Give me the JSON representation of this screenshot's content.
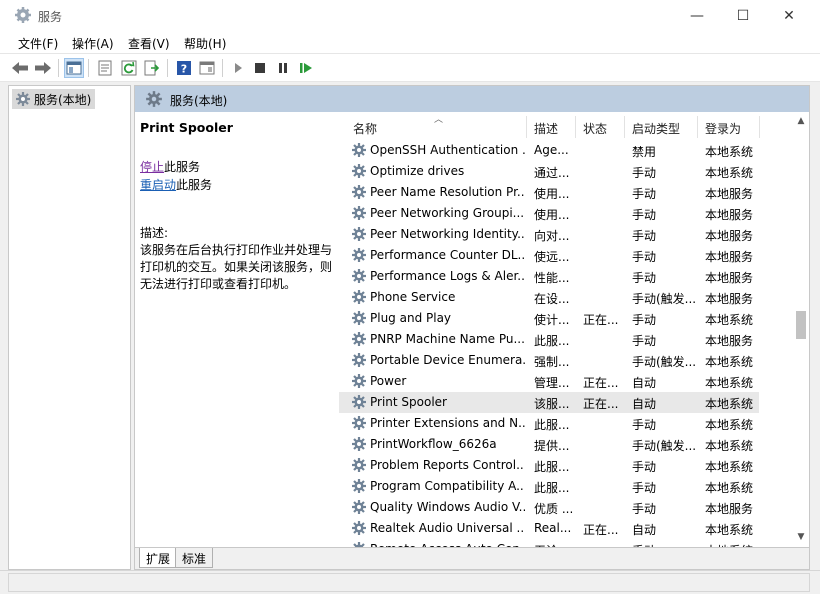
{
  "window": {
    "title": "服务",
    "controls": {
      "minimize": "—",
      "maximize": "☐",
      "close": "✕"
    }
  },
  "menu": {
    "items": [
      "文件(F)",
      "操作(A)",
      "查看(V)",
      "帮助(H)"
    ]
  },
  "toolbar": {
    "icons": [
      "back-arrow-icon",
      "forward-arrow-icon",
      "console-tree-icon",
      "properties-icon",
      "refresh-icon",
      "export-list-icon",
      "help-icon",
      "show-hide-icon",
      "start-service-icon",
      "stop-service-icon",
      "pause-service-icon",
      "restart-service-icon"
    ]
  },
  "tree": {
    "selected": "服务(本地)"
  },
  "content": {
    "header": "服务(本地)",
    "selected_service": "Print Spooler",
    "actions": [
      {
        "link": "停止",
        "suffix": "此服务"
      },
      {
        "link": "重启动",
        "suffix": "此服务"
      }
    ],
    "desc_label": "描述:",
    "desc_text": "该服务在后台执行打印作业并处理与打印机的交互。如果关闭该服务，则无法进行打印或查看打印机。"
  },
  "columns": {
    "name": "名称",
    "desc": "描述",
    "status": "状态",
    "startup": "启动类型",
    "logon": "登录为"
  },
  "services": [
    {
      "name": "OpenSSH Authentication ...",
      "desc": "Age...",
      "status": "",
      "startup": "禁用",
      "logon": "本地系统"
    },
    {
      "name": "Optimize drives",
      "desc": "通过...",
      "status": "",
      "startup": "手动",
      "logon": "本地系统"
    },
    {
      "name": "Peer Name Resolution Pr...",
      "desc": "使用...",
      "status": "",
      "startup": "手动",
      "logon": "本地服务"
    },
    {
      "name": "Peer Networking Groupi...",
      "desc": "使用...",
      "status": "",
      "startup": "手动",
      "logon": "本地服务"
    },
    {
      "name": "Peer Networking Identity...",
      "desc": "向对...",
      "status": "",
      "startup": "手动",
      "logon": "本地服务"
    },
    {
      "name": "Performance Counter DL...",
      "desc": "使远...",
      "status": "",
      "startup": "手动",
      "logon": "本地服务"
    },
    {
      "name": "Performance Logs & Aler...",
      "desc": "性能...",
      "status": "",
      "startup": "手动",
      "logon": "本地服务"
    },
    {
      "name": "Phone Service",
      "desc": "在设...",
      "status": "",
      "startup": "手动(触发...",
      "logon": "本地服务"
    },
    {
      "name": "Plug and Play",
      "desc": "使计...",
      "status": "正在...",
      "startup": "手动",
      "logon": "本地系统"
    },
    {
      "name": "PNRP Machine Name Pu...",
      "desc": "此服...",
      "status": "",
      "startup": "手动",
      "logon": "本地服务"
    },
    {
      "name": "Portable Device Enumera...",
      "desc": "强制...",
      "status": "",
      "startup": "手动(触发...",
      "logon": "本地系统"
    },
    {
      "name": "Power",
      "desc": "管理...",
      "status": "正在...",
      "startup": "自动",
      "logon": "本地系统"
    },
    {
      "name": "Print Spooler",
      "desc": "该服...",
      "status": "正在...",
      "startup": "自动",
      "logon": "本地系统"
    },
    {
      "name": "Printer Extensions and N...",
      "desc": "此服...",
      "status": "",
      "startup": "手动",
      "logon": "本地系统"
    },
    {
      "name": "PrintWorkflow_6626a",
      "desc": "提供...",
      "status": "",
      "startup": "手动(触发...",
      "logon": "本地系统"
    },
    {
      "name": "Problem Reports Control...",
      "desc": "此服...",
      "status": "",
      "startup": "手动",
      "logon": "本地系统"
    },
    {
      "name": "Program Compatibility A...",
      "desc": "此服...",
      "status": "",
      "startup": "手动",
      "logon": "本地系统"
    },
    {
      "name": "Quality Windows Audio V...",
      "desc": "优质 ...",
      "status": "",
      "startup": "手动",
      "logon": "本地服务"
    },
    {
      "name": "Realtek Audio Universal ...",
      "desc": "Real...",
      "status": "正在...",
      "startup": "自动",
      "logon": "本地系统"
    },
    {
      "name": "Remote Access Auto Con...",
      "desc": "无论...",
      "status": "",
      "startup": "手动",
      "logon": "本地系统"
    }
  ],
  "selected_index": 12,
  "tabs": [
    "扩展",
    "标准"
  ],
  "colors": {
    "header_bg": "#bccde0",
    "link": "#1a5fb4",
    "visited_link": "#7a2fa0",
    "selection": "#e8e8e8"
  }
}
